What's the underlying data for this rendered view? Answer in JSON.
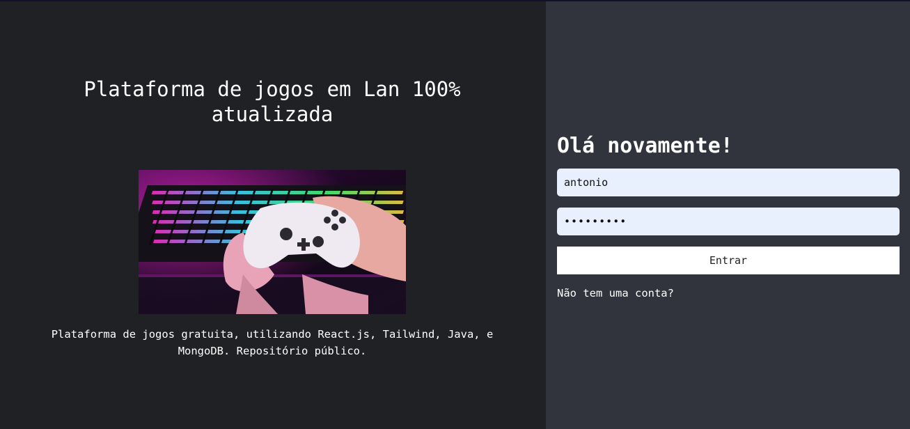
{
  "hero": {
    "title": "Plataforma de jogos em Lan 100% atualizada",
    "image_description": "gaming-controller-keyboard-photo",
    "description": "Plataforma de jogos gratuita, utilizando React.js, Tailwind, Java, e MongoDB. Repositório público."
  },
  "login": {
    "title": "Olá novamente!",
    "username_value": "antonio",
    "password_value": "•••••••••",
    "submit_label": "Entrar",
    "signup_link": "Não tem uma conta?"
  },
  "colors": {
    "left_bg": "#202124",
    "right_bg": "#31343c",
    "input_bg": "#e8f0fe",
    "button_bg": "#ffffff"
  }
}
